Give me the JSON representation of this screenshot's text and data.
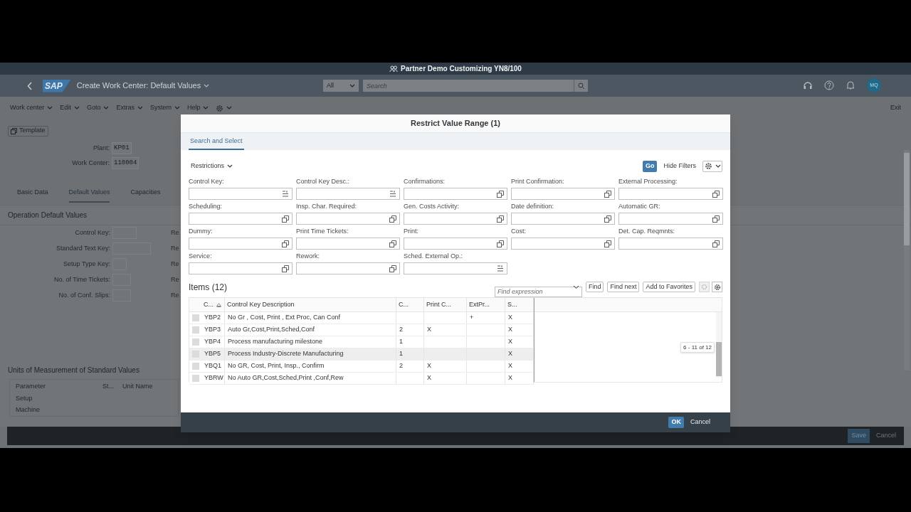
{
  "shell": {
    "system_title": "Partner Demo Customizing YN8/100",
    "logo": "SAP",
    "app_title": "Create Work Center: Default Values",
    "search_scope": "All",
    "search_placeholder": "Search",
    "avatar": "MQ"
  },
  "menu": [
    "Work center",
    "Edit",
    "Goto",
    "Extras",
    "System",
    "Help"
  ],
  "exit": "Exit",
  "template_button": "Template",
  "header_fields": [
    {
      "label": "Plant:",
      "value": "KP01"
    },
    {
      "label": "Work Center:",
      "value": "110004"
    }
  ],
  "tabs": [
    {
      "label": "Basic Data",
      "selected": false
    },
    {
      "label": "Default Values",
      "selected": true
    },
    {
      "label": "Capacities",
      "selected": false
    }
  ],
  "operation_defaults": {
    "title": "Operation Default Values",
    "fields": [
      {
        "label": "Control Key:",
        "side": "Re"
      },
      {
        "label": "Standard Text Key:",
        "side": "Re"
      },
      {
        "label": "Setup Type Key:",
        "side": "Re"
      },
      {
        "label": "No. of Time Tickets:",
        "side": "Re"
      },
      {
        "label": "No. of Conf. Slips:",
        "side": "Re"
      }
    ]
  },
  "units": {
    "title": "Units of Measurement of Standard Values",
    "columns": [
      "Parameter",
      "St...",
      "Unit Name"
    ],
    "rows": [
      "Setup",
      "Machine"
    ]
  },
  "footer_buttons": [
    "Save",
    "Cancel"
  ],
  "dialog": {
    "title": "Restrict Value Range (1)",
    "tabs": [
      {
        "label": "Search and Select",
        "selected": true
      }
    ],
    "restrictions": "Restrictions",
    "go": "Go",
    "hide_filters": "Hide Filters",
    "filters": [
      {
        "label": "Control Key:",
        "kind": "list"
      },
      {
        "label": "Control Key Desc.:",
        "kind": "list"
      },
      {
        "label": "Confirmations:",
        "kind": "copy"
      },
      {
        "label": "Print Confirmation:",
        "kind": "copy"
      },
      {
        "label": "External Processing:",
        "kind": "copy"
      },
      {
        "label": "Scheduling:",
        "kind": "copy"
      },
      {
        "label": "Insp. Char. Required:",
        "kind": "copy"
      },
      {
        "label": "Gen. Costs Activity:",
        "kind": "copy"
      },
      {
        "label": "Date definition:",
        "kind": "copy"
      },
      {
        "label": "Automatic GR:",
        "kind": "copy"
      },
      {
        "label": "Dummy:",
        "kind": "copy"
      },
      {
        "label": "Print Time Tickets:",
        "kind": "copy"
      },
      {
        "label": "Print:",
        "kind": "copy"
      },
      {
        "label": "Cost:",
        "kind": "copy"
      },
      {
        "label": "Det. Cap. Reqmnts:",
        "kind": "copy"
      },
      {
        "label": "Service:",
        "kind": "copy"
      },
      {
        "label": "Rework:",
        "kind": "copy"
      },
      {
        "label": "Sched. External Op.:",
        "kind": "list"
      }
    ],
    "items_title": "Items (12)",
    "find_placeholder": "Find expression",
    "find_buttons": [
      "Find",
      "Find next",
      "Add to Favorites"
    ],
    "columns": [
      {
        "label": "C...",
        "sorted": true
      },
      {
        "label": "Control Key Description",
        "sorted": false
      },
      {
        "label": "C...",
        "sorted": false
      },
      {
        "label": "Print C...",
        "sorted": false
      },
      {
        "label": "ExtPr...",
        "sorted": false
      },
      {
        "label": "S...",
        "sorted": false
      }
    ],
    "rows": [
      {
        "cells": [
          "YBP2",
          "No Gr , Cost, Print , Ext Proc, Can Conf",
          "",
          "",
          "+",
          "X"
        ],
        "highlighted": false
      },
      {
        "cells": [
          "YBP3",
          "Auto Gr,Cost,Print,Sched,Conf",
          "2",
          "X",
          "",
          "X"
        ],
        "highlighted": false
      },
      {
        "cells": [
          "YBP4",
          "Process manufacturing milestone",
          "1",
          "",
          "",
          "X"
        ],
        "highlighted": false
      },
      {
        "cells": [
          "YBP5",
          "Process Industry-Discrete Manufacturing",
          "1",
          "",
          "",
          "X"
        ],
        "highlighted": true
      },
      {
        "cells": [
          "YBQ1",
          "No GR, Cost, Print, Insp., Confirm",
          "2",
          "X",
          "",
          "X"
        ],
        "highlighted": false
      },
      {
        "cells": [
          "YBRW",
          "No Auto GR,Cost,Sched,Print ,Conf,Rew",
          "",
          "X",
          "",
          "X"
        ],
        "highlighted": false
      }
    ],
    "scroll_tooltip": "6 - 11 of 12",
    "buttons": [
      {
        "label": "OK",
        "kind": "primary"
      },
      {
        "label": "Cancel",
        "kind": "plain"
      }
    ]
  }
}
